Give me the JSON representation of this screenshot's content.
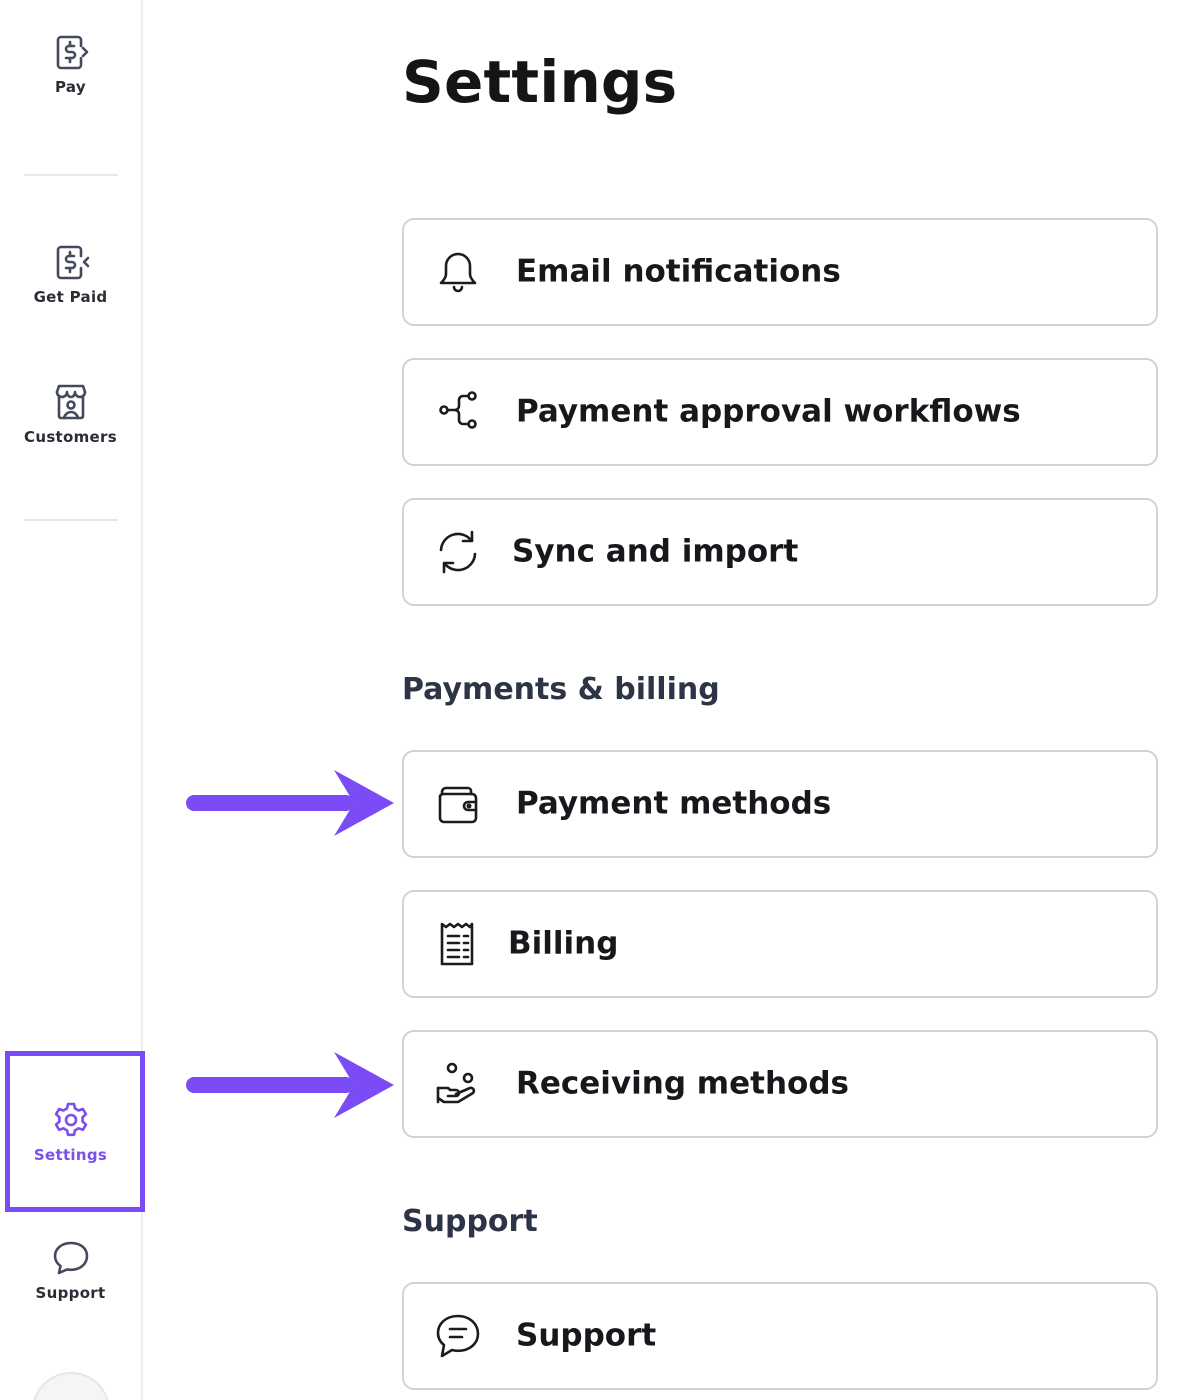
{
  "sidebar": {
    "items": [
      {
        "label": "Pay",
        "icon": "invoice-dollar-out-icon"
      },
      {
        "label": "Get Paid",
        "icon": "invoice-dollar-in-icon"
      },
      {
        "label": "Customers",
        "icon": "storefront-user-icon"
      },
      {
        "label": "Settings",
        "icon": "gear-icon",
        "active": true
      },
      {
        "label": "Support",
        "icon": "chat-bubble-icon"
      }
    ]
  },
  "main": {
    "title": "Settings",
    "cards_top": [
      {
        "label": "Email notifications",
        "icon": "bell-icon"
      },
      {
        "label": "Payment approval workflows",
        "icon": "workflow-branch-icon"
      },
      {
        "label": "Sync and import",
        "icon": "sync-arrows-icon"
      }
    ],
    "payments_heading": "Payments & billing",
    "cards_payments": [
      {
        "label": "Payment methods",
        "icon": "wallet-icon"
      },
      {
        "label": "Billing",
        "icon": "receipt-icon"
      },
      {
        "label": "Receiving methods",
        "icon": "hand-receiving-icon"
      }
    ],
    "support_heading": "Support",
    "cards_support": [
      {
        "label": "Support",
        "icon": "message-bubble-icon"
      }
    ]
  },
  "annotations": {
    "arrow_color": "#7b4cf6",
    "highlight_color": "#7b4cf6"
  }
}
